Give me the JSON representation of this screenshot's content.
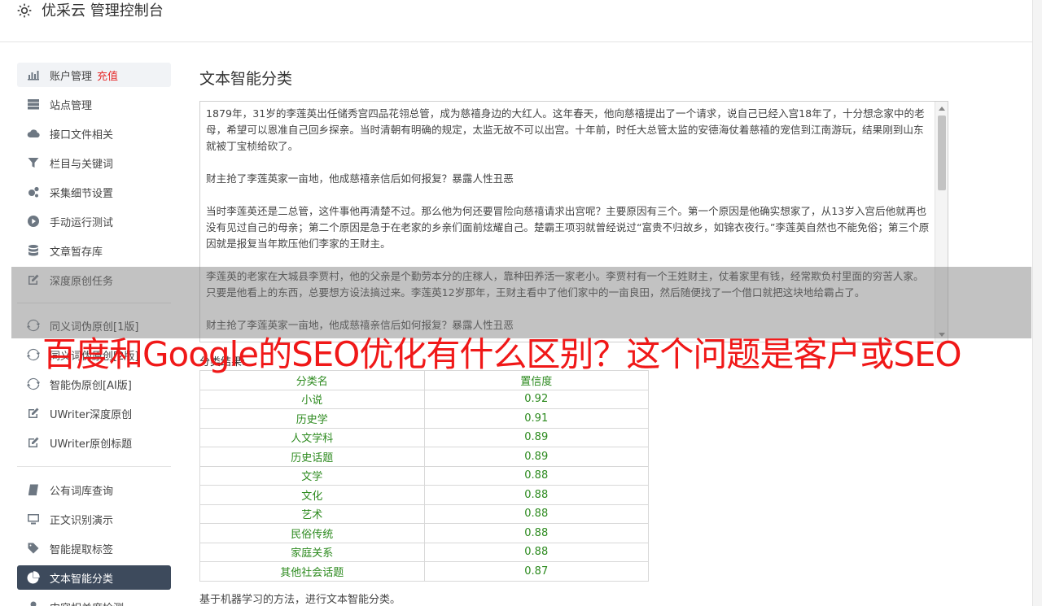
{
  "header": {
    "icon": "gear-icon",
    "title": "优采云 管理控制台"
  },
  "sidebar": {
    "items": [
      {
        "label": "账户管理",
        "badge": "充值",
        "icon": "bar-chart-icon"
      },
      {
        "label": "站点管理",
        "icon": "server-icon"
      },
      {
        "label": "接口文件相关",
        "icon": "cloud-upload-icon"
      },
      {
        "label": "栏目与关键词",
        "icon": "filter-icon"
      },
      {
        "label": "采集细节设置",
        "icon": "gears-icon"
      },
      {
        "label": "手动运行测试",
        "icon": "play-circle-icon"
      },
      {
        "label": "文章暂存库",
        "icon": "database-icon"
      },
      {
        "label": "深度原创任务",
        "icon": "edit-icon"
      },
      {
        "label": "同义词伪原创[1版]",
        "icon": "refresh-icon"
      },
      {
        "label": "同义词伪原创[2版]",
        "icon": "refresh-icon"
      },
      {
        "label": "智能伪原创[AI版]",
        "icon": "refresh-icon"
      },
      {
        "label": "UWriter深度原创",
        "icon": "edit-icon"
      },
      {
        "label": "UWriter原创标题",
        "icon": "edit-icon"
      },
      {
        "label": "公有词库查询",
        "icon": "book-icon"
      },
      {
        "label": "正文识别演示",
        "icon": "desktop-icon"
      },
      {
        "label": "智能提取标签",
        "icon": "tag-icon"
      },
      {
        "label": "文本智能分类",
        "icon": "pie-chart-icon"
      },
      {
        "label": "内容相关度检测",
        "icon": "user-icon"
      }
    ]
  },
  "main": {
    "title": "文本智能分类",
    "paragraphs": [
      "1879年，31岁的李莲英出任储秀宫四品花翎总管，成为慈禧身边的大红人。这年春天，他向慈禧提出了一个请求，说自己已经入宫18年了，十分想念家中的老母，希望可以恩准自己回乡探亲。当时清朝有明确的规定，太监无故不可以出宫。十年前，时任大总管太监的安德海仗着慈禧的宠信到江南游玩，结果刚到山东就被丁宝桢给砍了。",
      "财主抢了李莲英家一亩地，他成慈禧亲信后如何报复？暴露人性丑恶",
      "当时李莲英还是二总管，这件事他再清楚不过。那么他为何还要冒险向慈禧请求出宫呢？主要原因有三个。第一个原因是他确实想家了，从13岁入宫后他就再也没有见过自己的母亲；第二个原因是急于在老家的乡亲们面前炫耀自己。楚霸王项羽就曾经说过“富贵不归故乡，如锦衣夜行。”李莲英自然也不能免俗；第三个原因就是报复当年欺压他们李家的王财主。",
      "李莲英的老家在大城县李贾村，他的父亲是个勤劳本分的庄稼人，靠种田养活一家老小。李贾村有一个王姓财主，仗着家里有钱，经常欺负村里面的穷苦人家。只要是他看上的东西，总要想方设法搞过来。李莲英12岁那年，王财主看中了他们家中的一亩良田，然后随便找了一个借口就把这块地给霸占了。",
      "财主抢了李莲英家一亩地，他成慈禧亲信后如何报复？暴露人性丑恶"
    ],
    "result_label": "分类结果:",
    "table": {
      "headers": [
        "分类名",
        "置信度"
      ],
      "rows": [
        [
          "小说",
          "0.92"
        ],
        [
          "历史学",
          "0.91"
        ],
        [
          "人文学科",
          "0.89"
        ],
        [
          "历史话题",
          "0.89"
        ],
        [
          "文学",
          "0.88"
        ],
        [
          "文化",
          "0.88"
        ],
        [
          "艺术",
          "0.88"
        ],
        [
          "民俗传统",
          "0.88"
        ],
        [
          "家庭关系",
          "0.88"
        ],
        [
          "其他社会话题",
          "0.87"
        ]
      ]
    },
    "footnote": "基于机器学习的方法，进行文本智能分类。"
  },
  "overlay": {
    "caption": "百度和Google的SEO优化有什么区别？这个问题是客户或SEO"
  },
  "colors": {
    "active_dark": "#3d4a5c",
    "result_green": "#2c8a1e",
    "badge_red": "#e62e2e",
    "caption_red": "#f01818"
  }
}
